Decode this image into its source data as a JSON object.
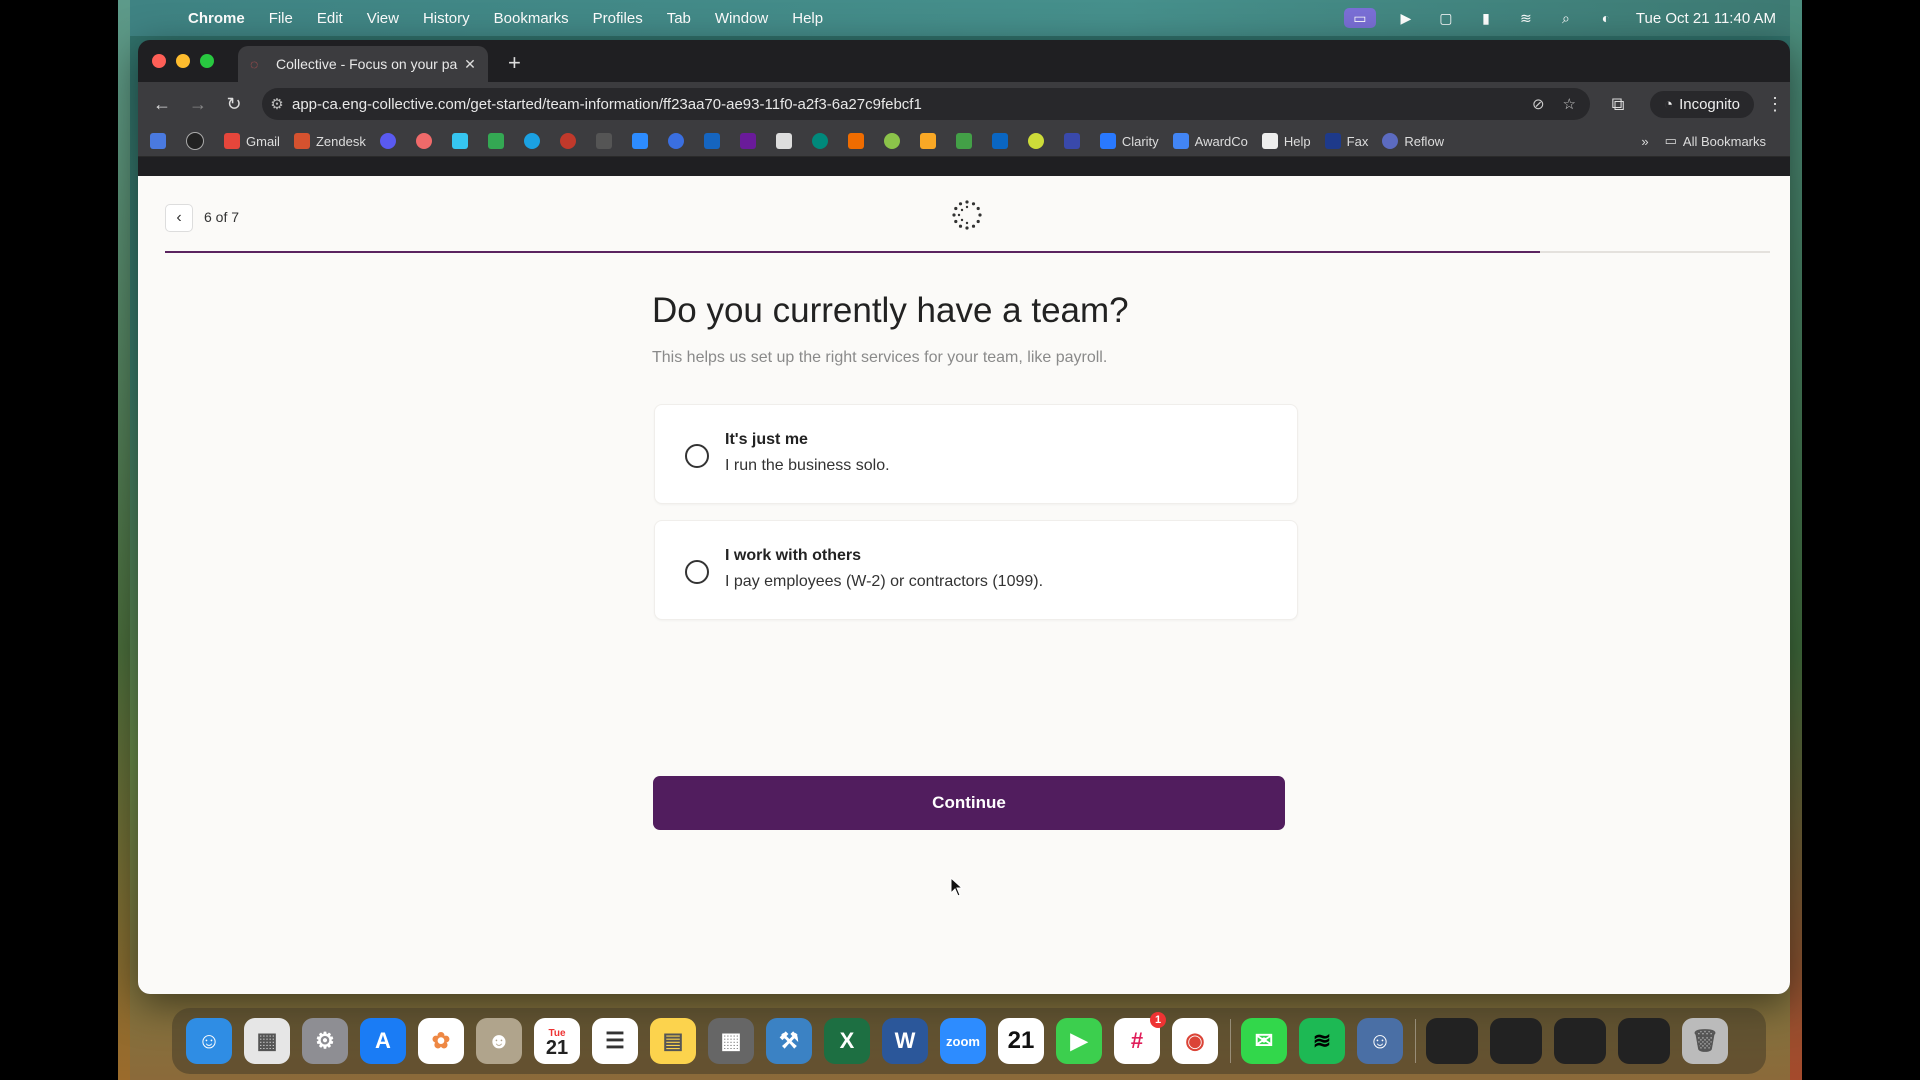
{
  "menubar": {
    "app": "Chrome",
    "menus": [
      "File",
      "Edit",
      "View",
      "History",
      "Bookmarks",
      "Profiles",
      "Tab",
      "Window",
      "Help"
    ],
    "datetime": "Tue Oct 21  11:40 AM"
  },
  "browser": {
    "tab_title": "Collective - Focus on your pa",
    "url": "app-ca.eng-collective.com/get-started/team-information/ff23aa70-ae93-11f0-a2f3-6a27c9febcf1",
    "incognito_label": "Incognito",
    "bookmarks": [
      "Gmail",
      "Zendesk",
      "Clarity",
      "AwardCo",
      "Help",
      "Fax",
      "Reflow"
    ],
    "all_bookmarks": "All Bookmarks"
  },
  "page": {
    "step": "6 of 7",
    "progress": 0.857,
    "question": "Do you currently have a team?",
    "subtitle": "This helps us set up the right services for your team, like payroll.",
    "options": [
      {
        "title": "It's just me",
        "desc": "I run the business solo."
      },
      {
        "title": "I work with others",
        "desc": "I pay employees (W-2) or contractors (1099)."
      }
    ],
    "continue": "Continue"
  },
  "colors": {
    "accent": "#511d5e",
    "progress": "#5b2460"
  },
  "dock": {
    "apps": [
      "finder",
      "launchpad",
      "system-settings",
      "app-store",
      "photos",
      "contacts",
      "calendar",
      "reminders",
      "notes",
      "calculator",
      "xcode",
      "excel",
      "word",
      "zoom",
      "calendar-21",
      "facetime",
      "slack",
      "chrome",
      "messages",
      "spotify",
      "finder-mini"
    ],
    "calendar_day": "21",
    "calendar_month": "Tue",
    "slack_badge": "1"
  }
}
